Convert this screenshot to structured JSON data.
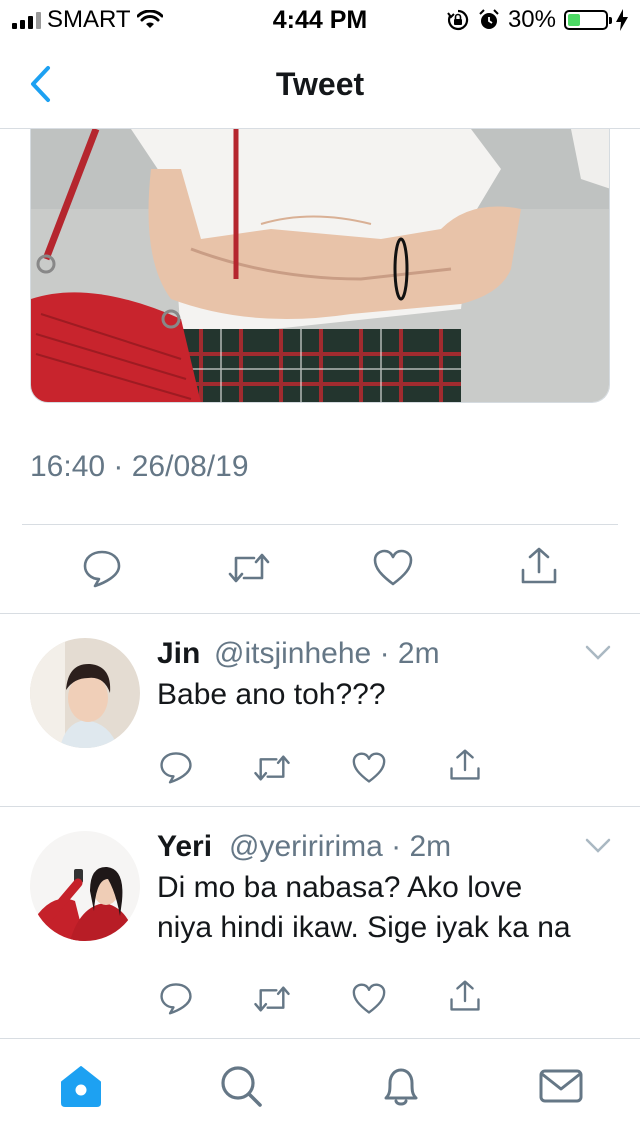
{
  "status_bar": {
    "carrier": "SMART",
    "time": "4:44 PM",
    "battery": "30%",
    "battery_level": 0.3
  },
  "header": {
    "title": "Tweet"
  },
  "tweet": {
    "timestamp": "16:40 · 26/08/19"
  },
  "replies": [
    {
      "name": "Jin",
      "handle": "@itsjinhehe",
      "dot": "·",
      "age": "2m",
      "text": "Babe ano toh???"
    },
    {
      "name": "Yeri",
      "handle": "@yeriririma",
      "dot": "·",
      "age": "2m",
      "text_line1": "Di mo ba nabasa? Ako love",
      "text_line2": "niya hindi ikaw. Sige iyak ka na"
    }
  ],
  "colors": {
    "accent": "#1da1f2",
    "icon_gray": "#657786",
    "divider": "#d8dde2"
  },
  "icons": {
    "actions": [
      "reply-icon",
      "retweet-icon",
      "like-icon",
      "share-icon"
    ],
    "tabs": [
      "home-icon",
      "search-icon",
      "notifications-icon",
      "messages-icon"
    ]
  }
}
